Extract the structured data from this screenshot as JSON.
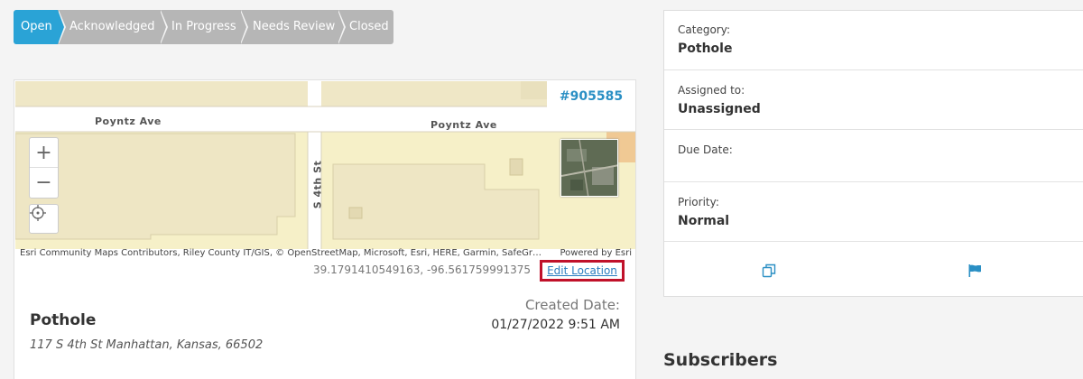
{
  "status_steps": [
    {
      "label": "Open",
      "active": true
    },
    {
      "label": "Acknowledged",
      "active": false
    },
    {
      "label": "In Progress",
      "active": false
    },
    {
      "label": "Needs Review",
      "active": false
    },
    {
      "label": "Closed",
      "active": false
    }
  ],
  "map": {
    "request_id": "#905585",
    "streets": [
      "Poyntz Ave",
      "Poyntz Ave",
      "S 4th St"
    ],
    "attribution": "Esri Community Maps Contributors, Riley County IT/GIS, © OpenStreetMap, Microsoft, Esri, HERE, Garmin, SafeGraph, GeoTechnologies, Inc, METI/NASA, USGS, EPA, NPS, USDA",
    "powered_by": "Powered by Esri",
    "coordinates": "39.1791410549163, -96.561759991375",
    "edit_location_label": "Edit Location"
  },
  "request": {
    "title": "Pothole",
    "address": "117 S 4th St Manhattan, Kansas, 66502",
    "created_label": "Created Date:",
    "created_value": "01/27/2022 9:51 AM"
  },
  "details": {
    "category_label": "Category:",
    "category_value": "Pothole",
    "assigned_label": "Assigned to:",
    "assigned_value": "Unassigned",
    "due_label": "Due Date:",
    "due_value": "",
    "priority_label": "Priority:",
    "priority_value": "Normal"
  },
  "actions": {
    "copy_icon": "copy-icon",
    "flag_icon": "flag-icon"
  },
  "subscribers_heading": "Subscribers",
  "colors": {
    "accent": "#2aa3d6",
    "step_inactive": "#b6b6b6",
    "highlight_border": "#c0112a",
    "id_text": "#2a8fc4"
  }
}
